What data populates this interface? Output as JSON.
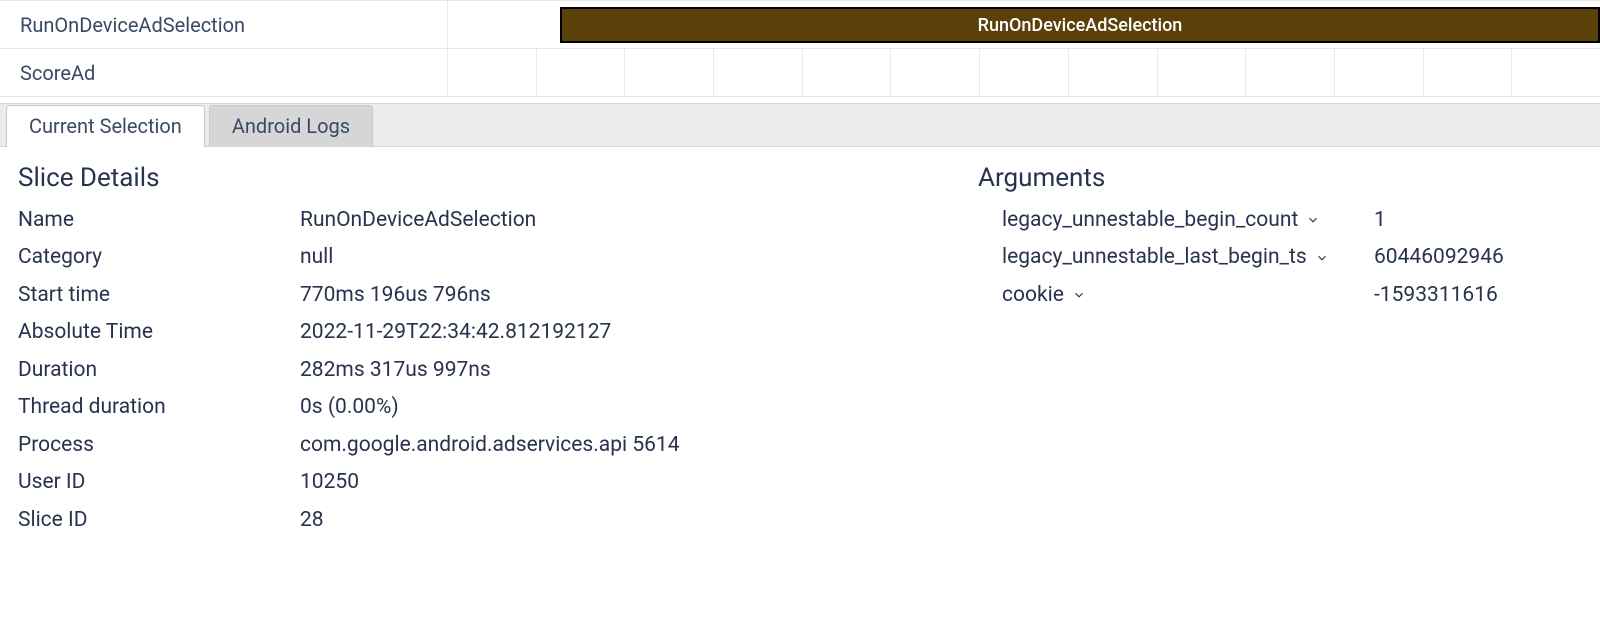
{
  "timeline": {
    "tracks": [
      {
        "label": "RunOnDeviceAdSelection",
        "slice_label": "RunOnDeviceAdSelection",
        "has_slice": true
      },
      {
        "label": "ScoreAd",
        "has_slice": false,
        "tick_count": 13
      }
    ]
  },
  "tabs": {
    "items": [
      {
        "label": "Current Selection",
        "active": true
      },
      {
        "label": "Android Logs",
        "active": false
      }
    ]
  },
  "slice_details": {
    "title": "Slice Details",
    "fields": [
      {
        "key": "Name",
        "value": "RunOnDeviceAdSelection"
      },
      {
        "key": "Category",
        "value": "null"
      },
      {
        "key": "Start time",
        "value": "770ms 196us 796ns"
      },
      {
        "key": "Absolute Time",
        "value": "2022-11-29T22:34:42.812192127"
      },
      {
        "key": "Duration",
        "value": "282ms 317us 997ns"
      },
      {
        "key": "Thread duration",
        "value": "0s (0.00%)"
      },
      {
        "key": "Process",
        "value": "com.google.android.adservices.api 5614"
      },
      {
        "key": "User ID",
        "value": "10250"
      },
      {
        "key": "Slice ID",
        "value": "28"
      }
    ]
  },
  "arguments": {
    "title": "Arguments",
    "items": [
      {
        "key": "legacy_unnestable_begin_count",
        "value": "1"
      },
      {
        "key": "legacy_unnestable_last_begin_ts",
        "value": "60446092946"
      },
      {
        "key": "cookie",
        "value": "-1593311616"
      }
    ]
  },
  "colors": {
    "slice_bg": "#5c4009",
    "text": "#28334d"
  }
}
